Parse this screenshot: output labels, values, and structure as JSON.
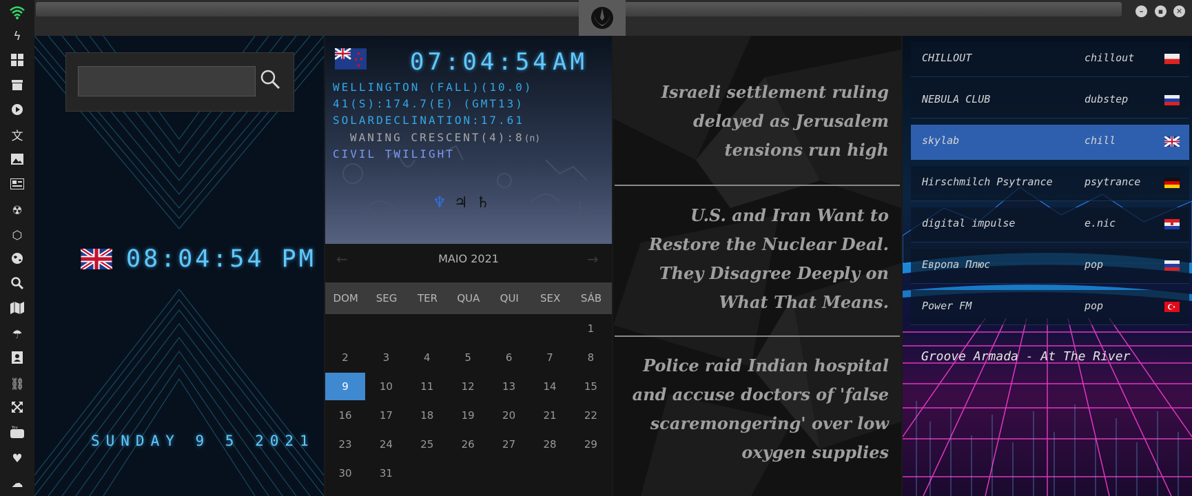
{
  "window": {
    "minimize": "–",
    "maximize": "▪",
    "close": "✕"
  },
  "sidebar_icons": [
    "wifi-icon",
    "lightning-icon",
    "windows-icon",
    "archive-icon",
    "play-icon",
    "translate-icon",
    "image-icon",
    "news-icon",
    "radiation-icon",
    "hexagon-icon",
    "globe-icon",
    "search-icon",
    "map-icon",
    "umbrella-icon",
    "contacts-icon",
    "link-icon",
    "expand-icon",
    "youtube-icon",
    "heart-icon",
    "cloud-icon"
  ],
  "search": {
    "placeholder": ""
  },
  "uk_clock": {
    "time": "08:04:54 PM",
    "date": "SUNDAY 9 5 2021"
  },
  "nz_clock": {
    "time": "07:04:54",
    "ampm": "AM"
  },
  "astro": {
    "location": "WELLINGTON (FALL)(10.0)",
    "coords": "41(S):174.7(E) (GMT13)",
    "solar": "SOLARDECLINATION:17.61",
    "moon": "WANING CRESCENT(4):8",
    "moon_suffix": "(n)",
    "twilight": "CIVIL TWILIGHT",
    "planets": [
      "♆",
      "♃",
      "♄"
    ]
  },
  "calendar": {
    "month": "MAIO 2021",
    "prev": "←",
    "next": "→",
    "days": [
      "DOM",
      "SEG",
      "TER",
      "QUA",
      "QUI",
      "SEX",
      "SÁB"
    ],
    "weeks": [
      [
        "",
        "",
        "",
        "",
        "",
        "",
        "1"
      ],
      [
        "2",
        "3",
        "4",
        "5",
        "6",
        "7",
        "8"
      ],
      [
        "9",
        "10",
        "11",
        "12",
        "13",
        "14",
        "15"
      ],
      [
        "16",
        "17",
        "18",
        "19",
        "20",
        "21",
        "22"
      ],
      [
        "23",
        "24",
        "25",
        "26",
        "27",
        "28",
        "29"
      ],
      [
        "30",
        "31",
        "",
        "",
        "",
        "",
        ""
      ]
    ],
    "today": "9"
  },
  "news": [
    "Israeli settlement ruling delayed as Jerusalem tensions run high",
    "U.S. and Iran Want to Restore the Nuclear Deal. They Disagree Deeply on What That Means.",
    "Police raid Indian hospital and accuse doctors of 'false scaremongering' over low oxygen supplies"
  ],
  "radio": {
    "stations": [
      {
        "name": "CHILLOUT",
        "genre": "chillout",
        "flag": "pl"
      },
      {
        "name": "NEBULA CLUB",
        "genre": "dubstep",
        "flag": "ru"
      },
      {
        "name": "skylab",
        "genre": "chill",
        "flag": "uk"
      },
      {
        "name": "Hirschmilch Psytrance",
        "genre": "psytrance",
        "flag": "de"
      },
      {
        "name": "digital impulse",
        "genre": "e.nic",
        "flag": "hr"
      },
      {
        "name": "Европа Плюс",
        "genre": "pop",
        "flag": "ru"
      },
      {
        "name": "Power FM",
        "genre": "pop",
        "flag": "tr"
      }
    ],
    "selected": "skylab",
    "now_playing": "Groove Armada - At The River"
  },
  "colors": {
    "accent_cyan": "#5fc9ff",
    "calendar_today": "#3f89d0",
    "radio_selected": "#2e5fae"
  }
}
